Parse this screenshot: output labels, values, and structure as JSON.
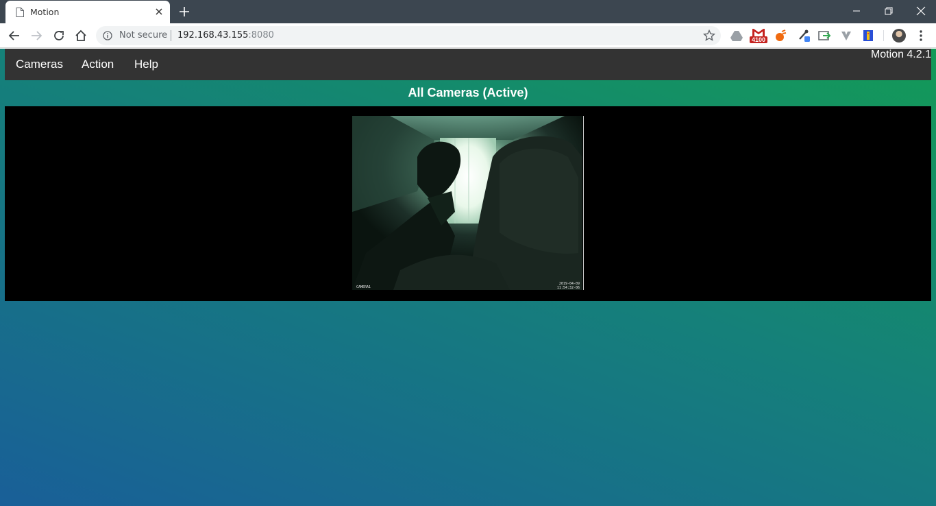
{
  "browser": {
    "tab_title": "Motion",
    "omnibox": {
      "security_label": "Not secure",
      "url_host": "192.168.43.155",
      "url_port": ":8080"
    },
    "extensions": {
      "gmail_count": "4100"
    }
  },
  "app": {
    "menu": {
      "cameras_label": "Cameras",
      "action_label": "Action",
      "help_label": "Help"
    },
    "version": "Motion 4.2.1",
    "page_title": "All Cameras (Active)",
    "camera": {
      "osd_left": "CAMERA1",
      "osd_date": "2019-04-09",
      "osd_time": "11:54:32-06"
    }
  },
  "colors": {
    "tabstrip_bg": "#3c4650",
    "navbar_bg": "#333333",
    "gradient_green": "#139a57",
    "gradient_blue": "#195f98"
  }
}
